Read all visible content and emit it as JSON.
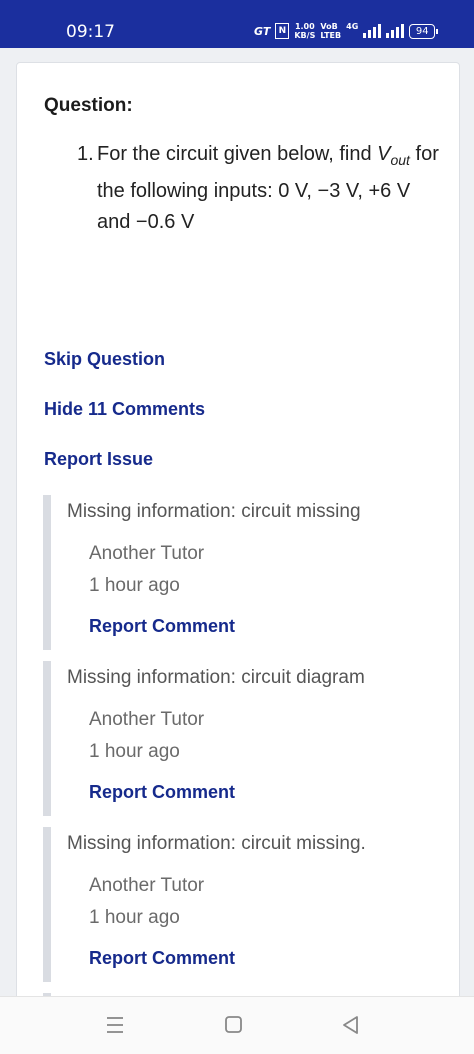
{
  "status_bar": {
    "time": "09:17",
    "carrier_icon": "GT",
    "nfc_icon": "N",
    "speed_value": "1.00",
    "speed_unit": "KB/S",
    "volte_top": "VoB",
    "volte_bottom": "LTEB",
    "network": "4G",
    "battery": "94"
  },
  "question": {
    "label": "Question:",
    "number": "1.",
    "text_before": "For the circuit given below, find ",
    "var_main": "V",
    "var_sub": "out",
    "text_after": " for the following inputs: 0 V, −3 V, +6 V and −0.6 V"
  },
  "actions": {
    "skip": "Skip Question",
    "hide_comments": "Hide 11 Comments",
    "report_issue": "Report Issue"
  },
  "comments": [
    {
      "text": "Missing information: circuit missing",
      "author": "Another Tutor",
      "time": "1 hour ago",
      "report": "Report Comment"
    },
    {
      "text": "Missing information: circuit diagram",
      "author": "Another Tutor",
      "time": "1 hour ago",
      "report": "Report Comment"
    },
    {
      "text": "Missing information: circuit missing.",
      "author": "Another Tutor",
      "time": "1 hour ago",
      "report": "Report Comment"
    }
  ],
  "nav": {
    "recents_icon": "menu-icon",
    "home_icon": "square-icon",
    "back_icon": "triangle-back-icon"
  }
}
